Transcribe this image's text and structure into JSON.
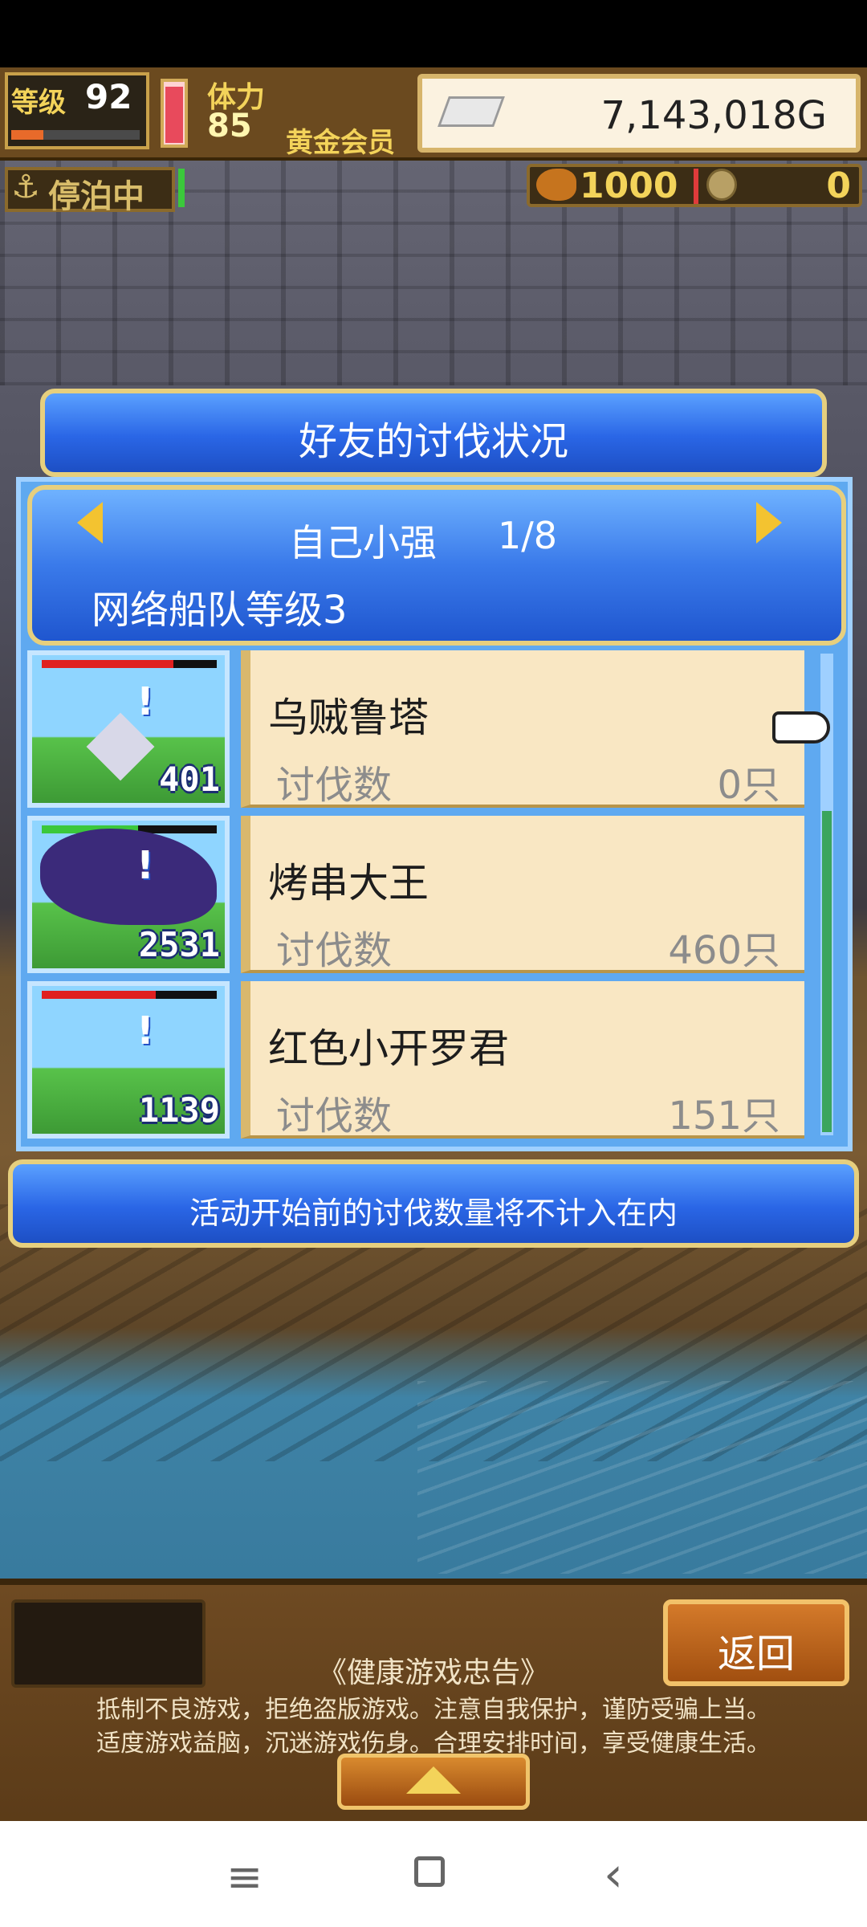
{
  "hud": {
    "level_label": "等级",
    "level_value": "92",
    "level_progress": 0.25,
    "stamina_label": "体力",
    "stamina_value": "85",
    "stamina_level": 0.95,
    "member_label": "黄金会员",
    "gold_value": "7,143,018G",
    "docked_label": "停泊中",
    "meat_value": "1000",
    "coin_value": "0",
    "icons": {
      "anchor": "anchor-icon",
      "gold": "silver-bar-icon",
      "meat": "meat-icon",
      "coin": "coin-icon"
    }
  },
  "dialog": {
    "title": "好友的讨伐状况",
    "friend_name": "自己小强",
    "friend_index": "1/8",
    "fleet_level": "网络船队等级3",
    "count_label": "讨伐数",
    "rows": [
      {
        "name": "乌贼鲁塔",
        "count": "0只",
        "thumb_number": "401",
        "hp": 0.75,
        "hp_color": "#e02020"
      },
      {
        "name": "烤串大王",
        "count": "460只",
        "thumb_number": "2531",
        "hp": 0.55,
        "hp_color": "#3bc83b"
      },
      {
        "name": "红色小开罗君",
        "count": "151只",
        "thumb_number": "1139",
        "hp": 0.65,
        "hp_color": "#e02020"
      }
    ],
    "notice": "活动开始前的讨伐数量将不计入在内"
  },
  "bottom": {
    "back_label": "返回",
    "advisory_title": "《健康游戏忠告》",
    "advisory_line1": "抵制不良游戏，拒绝盗版游戏。注意自我保护，谨防受骗上当。",
    "advisory_line2": "适度游戏益脑，沉迷游戏伤身。合理安排时间，享受健康生活。"
  },
  "nav": {
    "menu_glyph": "≡",
    "back_glyph": "‹"
  }
}
